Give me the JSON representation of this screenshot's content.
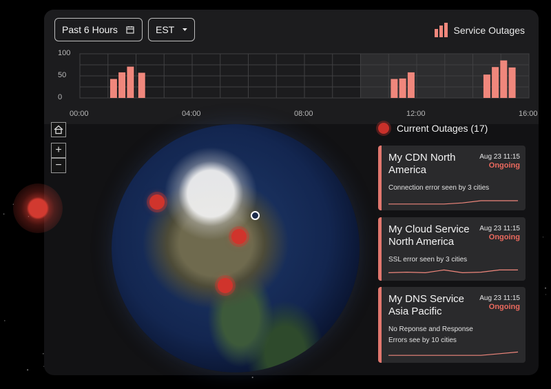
{
  "toolbar": {
    "time_range": "Past 6 Hours",
    "timezone": "EST",
    "legend_label": "Service Outages"
  },
  "chart_data": {
    "type": "bar",
    "title": "",
    "legend": [
      "Service Outages"
    ],
    "y_ticks": [
      "100",
      "50",
      "0"
    ],
    "ylim": [
      0,
      100
    ],
    "x_ticks": [
      "00:00",
      "04:00",
      "08:00",
      "12:00",
      "16:00"
    ],
    "xlim_hours": [
      0,
      16
    ],
    "highlight_range_hours": [
      10,
      16
    ],
    "series": [
      {
        "name": "Service Outages",
        "x_hours": [
          1.2,
          1.5,
          1.8,
          2.2,
          11.2,
          11.5,
          11.8,
          14.5,
          14.8,
          15.1,
          15.4
        ],
        "values": [
          43,
          58,
          71,
          57,
          43,
          44,
          58,
          53,
          70,
          85,
          69
        ]
      }
    ]
  },
  "outages": {
    "header": "Current Outages (17)",
    "cards": [
      {
        "title": "My CDN North America",
        "date": "Aug 23  11:15",
        "status": "Ongoing",
        "desc": "Connection error seen by 3 cities",
        "trend": [
          0.2,
          0.2,
          0.2,
          0.2,
          0.3,
          0.5,
          0.5,
          0.5
        ]
      },
      {
        "title": "My Cloud Service North America",
        "date": "Aug 23  11:15",
        "status": "Ongoing",
        "desc": "SSL error seen by 3 cities",
        "trend": [
          0.35,
          0.4,
          0.35,
          0.6,
          0.35,
          0.4,
          0.6,
          0.6
        ]
      },
      {
        "title": "My DNS Service Asia Pacific",
        "date": "Aug 23  11:15",
        "status": "Ongoing",
        "desc": "No Reponse and Response Errors see by 10 cities",
        "trend": [
          0.3,
          0.3,
          0.3,
          0.3,
          0.3,
          0.3,
          0.45,
          0.6
        ]
      }
    ]
  },
  "map": {
    "home_icon": "home-icon",
    "zoom_in": "+",
    "zoom_out": "−"
  },
  "colors": {
    "accent": "#f0877c",
    "marker": "#d0342c",
    "status": "#ec6a5e"
  }
}
